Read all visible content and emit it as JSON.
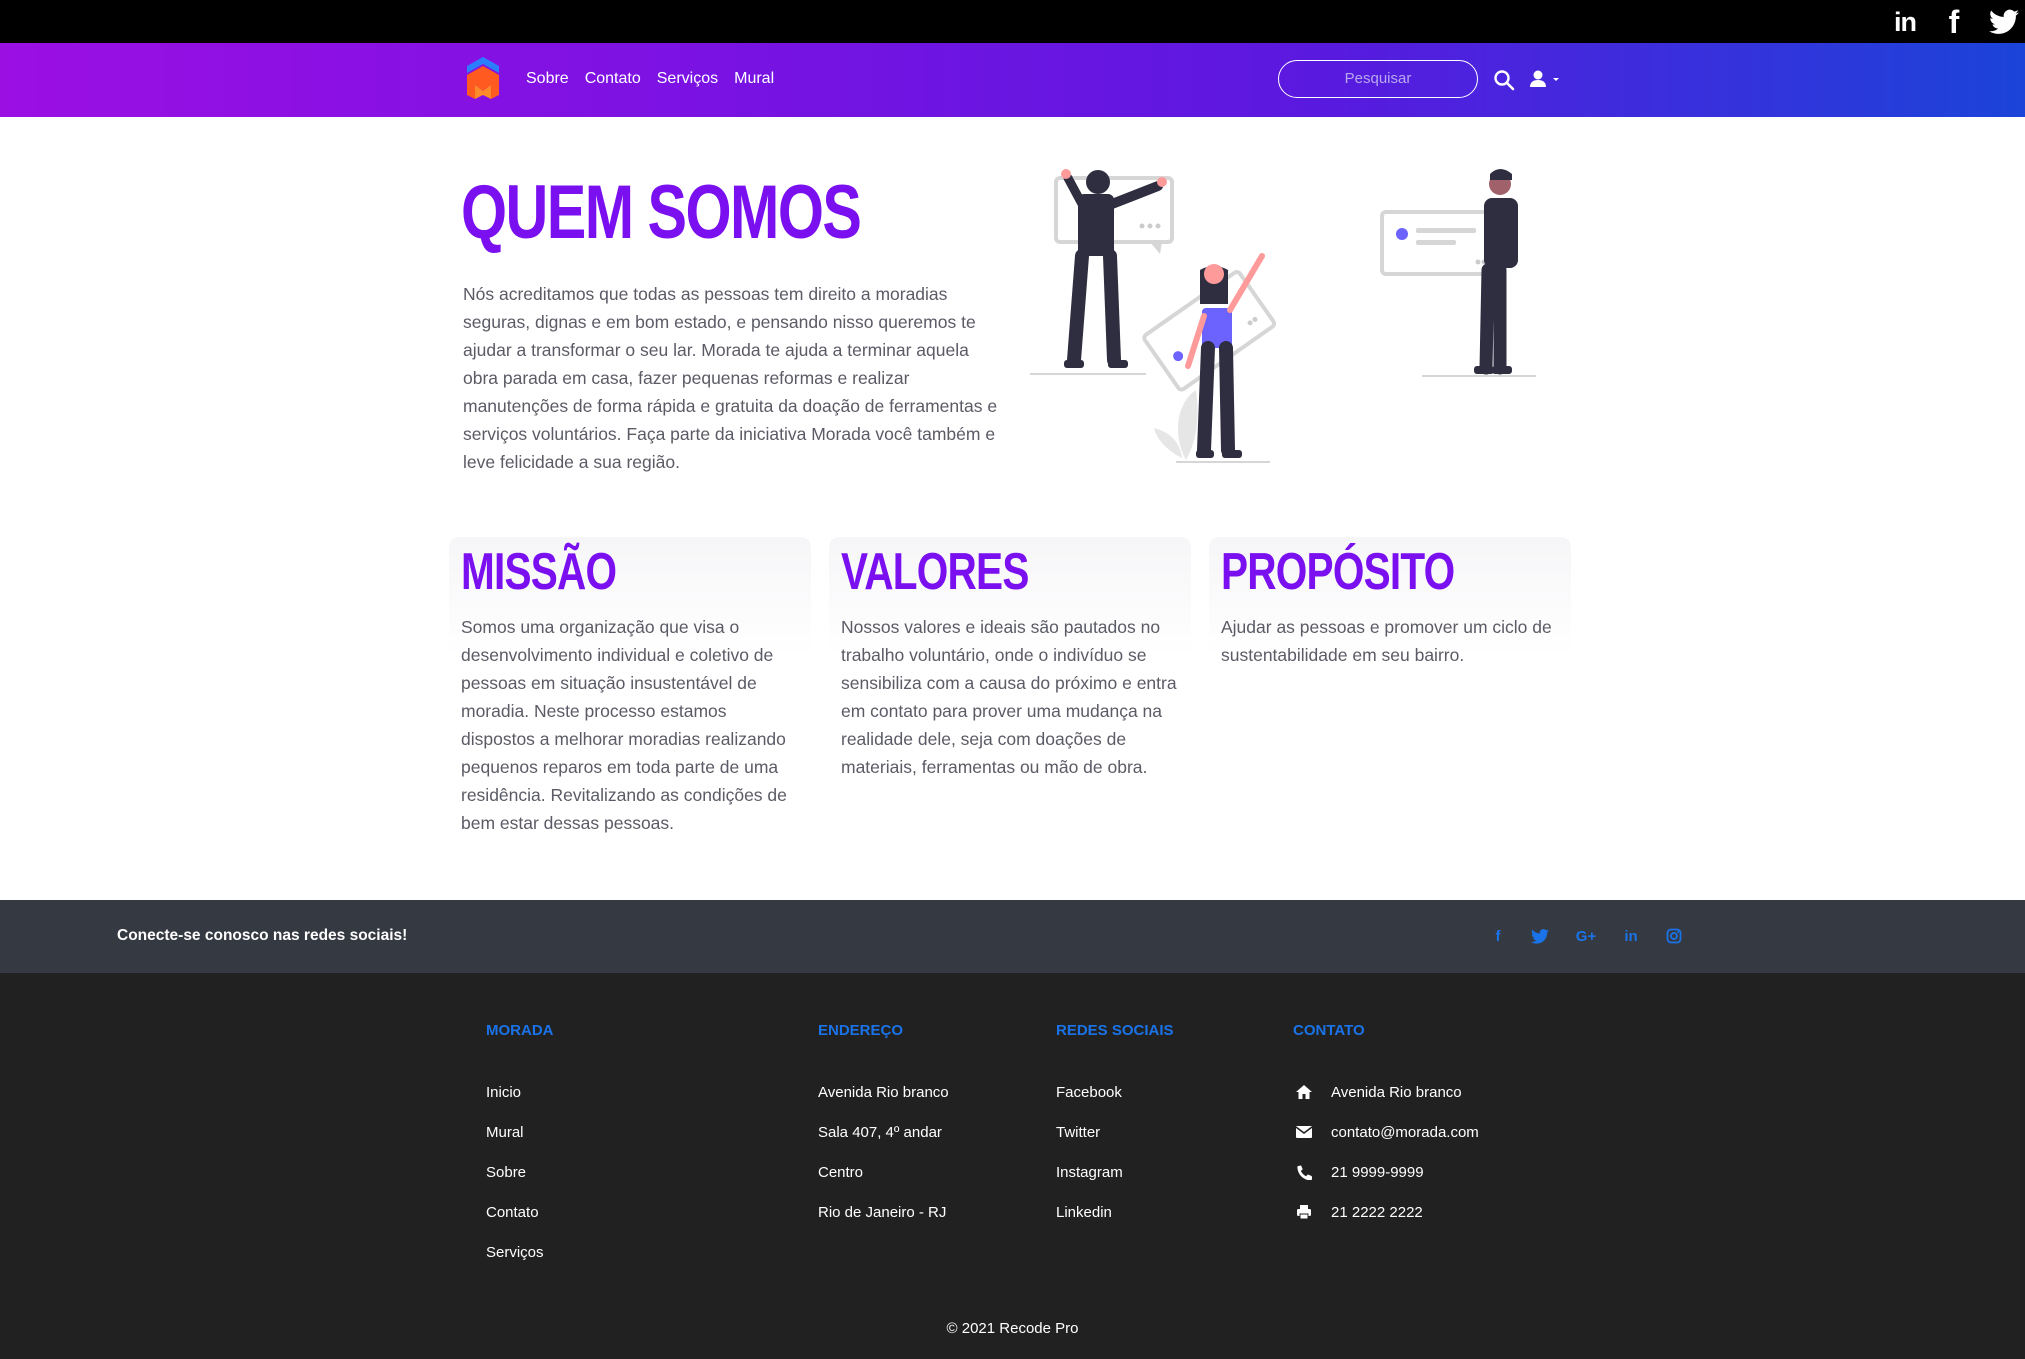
{
  "topbar": {
    "linkedin_label": "in",
    "facebook_label": "f"
  },
  "nav": {
    "links": [
      "Sobre",
      "Contato",
      "Serviços",
      "Mural"
    ],
    "search_placeholder": "Pesquisar"
  },
  "hero": {
    "title": "QUEM SOMOS",
    "text": "Nós acreditamos que todas as pessoas tem direito a moradias seguras, dignas e em bom estado, e pensando nisso queremos te ajudar a transformar o seu lar. Morada te ajuda a terminar aquela obra parada em casa, fazer pequenas reformas e realizar manutenções de forma rápida e gratuita da doação de ferramentas e serviços voluntários. Faça parte da iniciativa Morada você também e leve felicidade a sua região."
  },
  "cards": [
    {
      "title": "MISSÃO",
      "text": "Somos uma organização que visa o desenvolvimento individual e coletivo de pessoas em situação insustentável de moradia. Neste processo estamos dispostos a melhorar moradias realizando pequenos reparos em toda parte de uma residência. Revitalizando as condições de bem estar dessas pessoas."
    },
    {
      "title": "VALORES",
      "text": "Nossos valores e ideais são pautados no trabalho voluntário, onde o indivíduo se sensibiliza com a causa do próximo e entra em contato para prover uma mudança na realidade dele, seja com doações de materiais, ferramentas ou mão de obra."
    },
    {
      "title": "PROPÓSITO",
      "text": "Ajudar as pessoas e promover um ciclo de sustentabilidade em seu bairro."
    }
  ],
  "connect": {
    "text": "Conecte-se conosco nas redes sociais!",
    "icons": [
      "f",
      "G+",
      "in"
    ]
  },
  "footer": {
    "columns": [
      {
        "heading": "MORADA",
        "items": [
          "Inicio",
          "Mural",
          "Sobre",
          "Contato",
          "Serviços"
        ]
      },
      {
        "heading": "ENDEREÇO",
        "items": [
          "Avenida Rio branco",
          "Sala 407, 4º andar",
          "Centro",
          "Rio de Janeiro - RJ"
        ]
      },
      {
        "heading": "REDES SOCIAIS",
        "items": [
          "Facebook",
          "Twitter",
          "Instagram",
          "Linkedin"
        ]
      },
      {
        "heading": "CONTATO",
        "items": [
          "Avenida Rio branco",
          "contato@morada.com",
          "21 9999-9999",
          "21 2222 2222"
        ]
      }
    ],
    "copyright": "© 2021 Recode Pro"
  },
  "colors": {
    "accent": "#7a0ff0",
    "footer_link": "#1a73e8",
    "footer_bg": "#212121",
    "connect_bg": "#353942"
  }
}
